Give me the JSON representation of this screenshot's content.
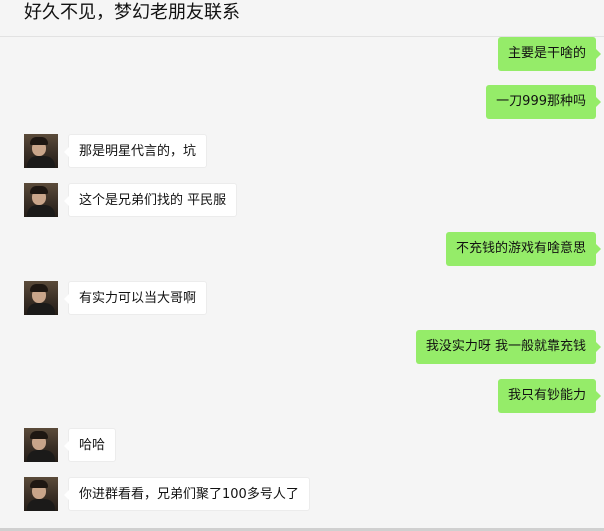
{
  "chat": {
    "title": "好久不见，梦幻老朋友联系",
    "messages": [
      {
        "side": "right",
        "text": "主要是干啥的"
      },
      {
        "side": "right",
        "text": "一刀999那种吗"
      },
      {
        "side": "left",
        "avatar": "user-avatar",
        "text": "那是明星代言的，坑"
      },
      {
        "side": "left",
        "avatar": "user-avatar",
        "text": "这个是兄弟们找的 平民服"
      },
      {
        "side": "right",
        "text": "不充钱的游戏有啥意思"
      },
      {
        "side": "left",
        "avatar": "user-avatar",
        "text": "有实力可以当大哥啊"
      },
      {
        "side": "right",
        "text": "我没实力呀 我一般就靠充钱"
      },
      {
        "side": "right",
        "text": "我只有钞能力"
      },
      {
        "side": "left",
        "avatar": "user-avatar",
        "text": "哈哈"
      },
      {
        "side": "left",
        "avatar": "user-avatar",
        "text": "你进群看看，兄弟们聚了100多号人了"
      }
    ]
  },
  "colors": {
    "background": "#f5f5f5",
    "outgoing_bubble": "#95ec69",
    "incoming_bubble": "#ffffff"
  }
}
